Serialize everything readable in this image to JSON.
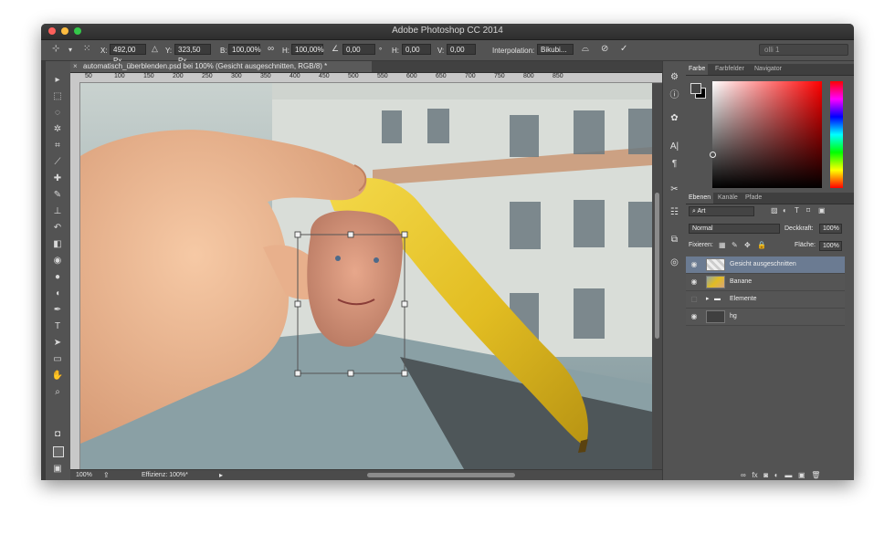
{
  "window": {
    "title": "Adobe Photoshop CC 2014"
  },
  "options": {
    "x_label": "X:",
    "x_value": "492,00 Px",
    "y_label": "Y:",
    "y_value": "323,50 Px",
    "w_label": "B:",
    "w_value": "100,00%",
    "h_label": "H:",
    "h_value": "100,00%",
    "angle_value": "0,00",
    "angle_unit": "°",
    "hskew_label": "H:",
    "hskew_value": "0,00",
    "vskew_label": "V:",
    "vskew_value": "0,00",
    "interp_label": "Interpolation:",
    "interp_value": "Bikubi...",
    "workspace": "olli 1"
  },
  "document": {
    "tab_title": "automatisch_überblenden.psd bei 100% (Gesicht ausgeschnitten, RGB/8) *",
    "ruler_ticks": [
      "50",
      "100",
      "150",
      "200",
      "250",
      "300",
      "350",
      "400",
      "450",
      "500",
      "550",
      "600",
      "650",
      "700",
      "750",
      "800",
      "850"
    ],
    "zoom": "100%",
    "efficiency": "Effizienz: 100%*"
  },
  "color_panel": {
    "tabs": [
      "Farbe",
      "Farbfelder",
      "Navigator"
    ],
    "active_tab": "Farbe"
  },
  "layers_panel": {
    "tabs": [
      "Ebenen",
      "Kanäle",
      "Pfade"
    ],
    "filter_label": "Art",
    "blend_mode": "Normal",
    "opacity_label": "Deckkraft:",
    "opacity_value": "100%",
    "lock_label": "Fixieren:",
    "fill_label": "Fläche:",
    "fill_value": "100%",
    "layers": [
      {
        "name": "Gesicht ausgeschnitten",
        "visible": true,
        "selected": true
      },
      {
        "name": "Banane",
        "visible": true,
        "selected": false
      },
      {
        "name": "Elemente",
        "visible": false,
        "selected": false
      },
      {
        "name": "hg",
        "visible": true,
        "selected": false
      }
    ]
  },
  "colors": {
    "accent": "#6b7b92",
    "banana": "#e6c32a",
    "chrome": "#535353"
  }
}
